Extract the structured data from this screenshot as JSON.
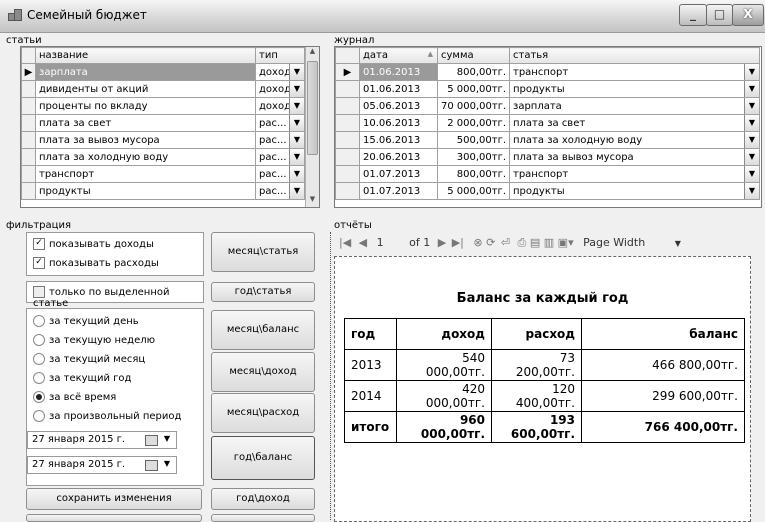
{
  "window": {
    "title": "Семейный бюджет",
    "min": "_",
    "max": "□",
    "close": "X"
  },
  "categories": {
    "section_label": "статьи",
    "columns": [
      "название",
      "тип"
    ],
    "rows": [
      {
        "name": "зарплата",
        "type": "доход"
      },
      {
        "name": "дивиденты от акций",
        "type": "доход"
      },
      {
        "name": "проценты по вкладу",
        "type": "доход"
      },
      {
        "name": "плата за свет",
        "type": "рас..."
      },
      {
        "name": "плата за вывоз мусора",
        "type": "рас..."
      },
      {
        "name": "плата за холодную воду",
        "type": "рас..."
      },
      {
        "name": "транспорт",
        "type": "рас..."
      },
      {
        "name": "продукты",
        "type": "рас..."
      }
    ]
  },
  "journal": {
    "section_label": "журнал",
    "columns": [
      "дата",
      "сумма",
      "статья"
    ],
    "sort_indicator": "▲",
    "rows": [
      {
        "date": "01.06.2013",
        "amount": "800,00тг.",
        "category": "транспорт"
      },
      {
        "date": "01.06.2013",
        "amount": "5 000,00тг.",
        "category": "продукты"
      },
      {
        "date": "05.06.2013",
        "amount": "70 000,00тг.",
        "category": "зарплата"
      },
      {
        "date": "10.06.2013",
        "amount": "2 000,00тг.",
        "category": "плата за свет"
      },
      {
        "date": "15.06.2013",
        "amount": "500,00тг.",
        "category": "плата за холодную воду"
      },
      {
        "date": "20.06.2013",
        "amount": "300,00тг.",
        "category": "плата за вывоз мусора"
      },
      {
        "date": "01.07.2013",
        "amount": "800,00тг.",
        "category": "транспорт"
      },
      {
        "date": "01.07.2013",
        "amount": "5 000,00тг.",
        "category": "продукты"
      }
    ]
  },
  "filter": {
    "section_label": "фильтрация",
    "show_income": {
      "label": "показывать доходы",
      "checked": true
    },
    "show_expense": {
      "label": "показывать расходы",
      "checked": true
    },
    "only_selected": {
      "label": "только по выделенной статье",
      "checked": false
    },
    "periods": [
      {
        "label": "за текущий день",
        "selected": false
      },
      {
        "label": "за текущую неделю",
        "selected": false
      },
      {
        "label": "за текущий месяц",
        "selected": false
      },
      {
        "label": "за текущий год",
        "selected": false
      },
      {
        "label": "за всё время",
        "selected": true
      },
      {
        "label": "за произвольный период",
        "selected": false
      }
    ],
    "date_from": "27  января  2015 г.",
    "date_to": "27  января  2015 г.",
    "save_button": "сохранить изменения"
  },
  "report_buttons": {
    "month_category": "месяц\\статья",
    "year_category": "год\\статья",
    "month_balance": "месяц\\баланс",
    "month_income": "месяц\\доход",
    "month_expense": "месяц\\расход",
    "year_balance": "год\\баланс",
    "year_income": "год\\доход"
  },
  "reports": {
    "section_label": "отчёты",
    "toolbar": {
      "page_current": "1",
      "page_of": "of 1",
      "zoom": "Page Width"
    },
    "title": "Баланс за каждый год",
    "columns": [
      "год",
      "доход",
      "расход",
      "баланс"
    ],
    "rows": [
      {
        "year": "2013",
        "income": "540 000,00тг.",
        "expense": "73 200,00тг.",
        "balance": "466 800,00тг."
      },
      {
        "year": "2014",
        "income": "420 000,00тг.",
        "expense": "120 400,00тг.",
        "balance": "299 600,00тг."
      }
    ],
    "total": {
      "label": "итого",
      "income": "960 000,00тг.",
      "expense": "193 600,00тг.",
      "balance": "766 400,00тг."
    }
  }
}
